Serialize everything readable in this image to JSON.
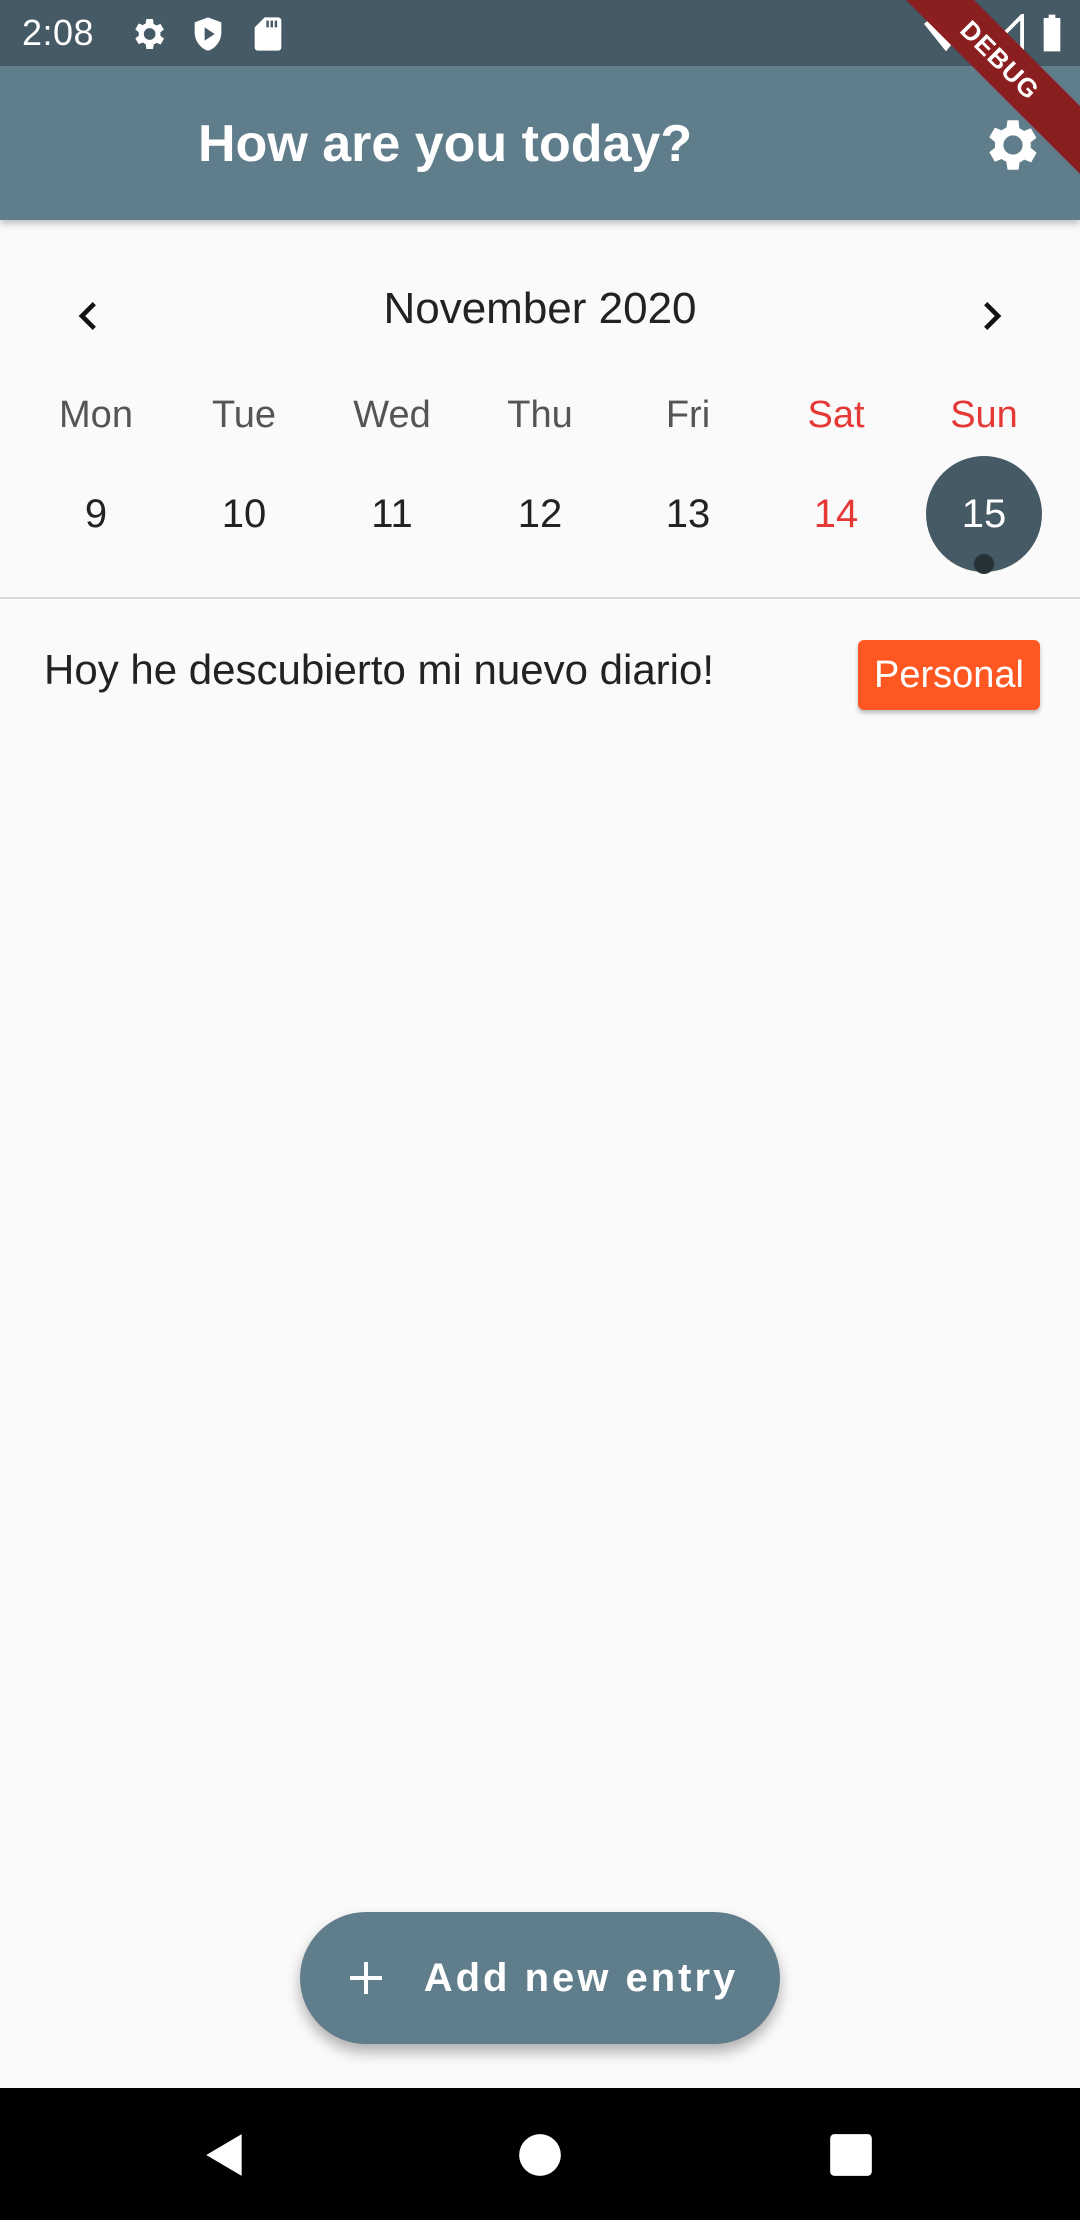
{
  "status_bar": {
    "time": "2:08",
    "left_icons": [
      "settings-icon",
      "shield-play-icon",
      "sd-card-icon"
    ],
    "right_icons": [
      "wifi-icon",
      "signal-icon",
      "battery-icon"
    ]
  },
  "app_bar": {
    "title": "How are you today?",
    "settings_icon": "gear-icon",
    "color": "#607d8b"
  },
  "debug_banner": "DEBUG",
  "calendar": {
    "month_title": "November 2020",
    "prev_icon": "chevron-left-icon",
    "next_icon": "chevron-right-icon",
    "weekdays": [
      "Mon",
      "Tue",
      "Wed",
      "Thu",
      "Fri",
      "Sat",
      "Sun"
    ],
    "days": [
      "9",
      "10",
      "11",
      "12",
      "13",
      "14",
      "15"
    ],
    "selected_day": "15",
    "selected_color": "#455a64",
    "weekend_color": "#e53935"
  },
  "entries": [
    {
      "text": "Hoy he descubierto mi nuevo diario!",
      "tag": "Personal",
      "tag_color": "#ff5722"
    }
  ],
  "fab": {
    "label": "Add new entry",
    "icon": "plus-icon"
  },
  "nav_bar": {
    "icons": [
      "back-icon",
      "home-icon",
      "recents-icon"
    ]
  }
}
